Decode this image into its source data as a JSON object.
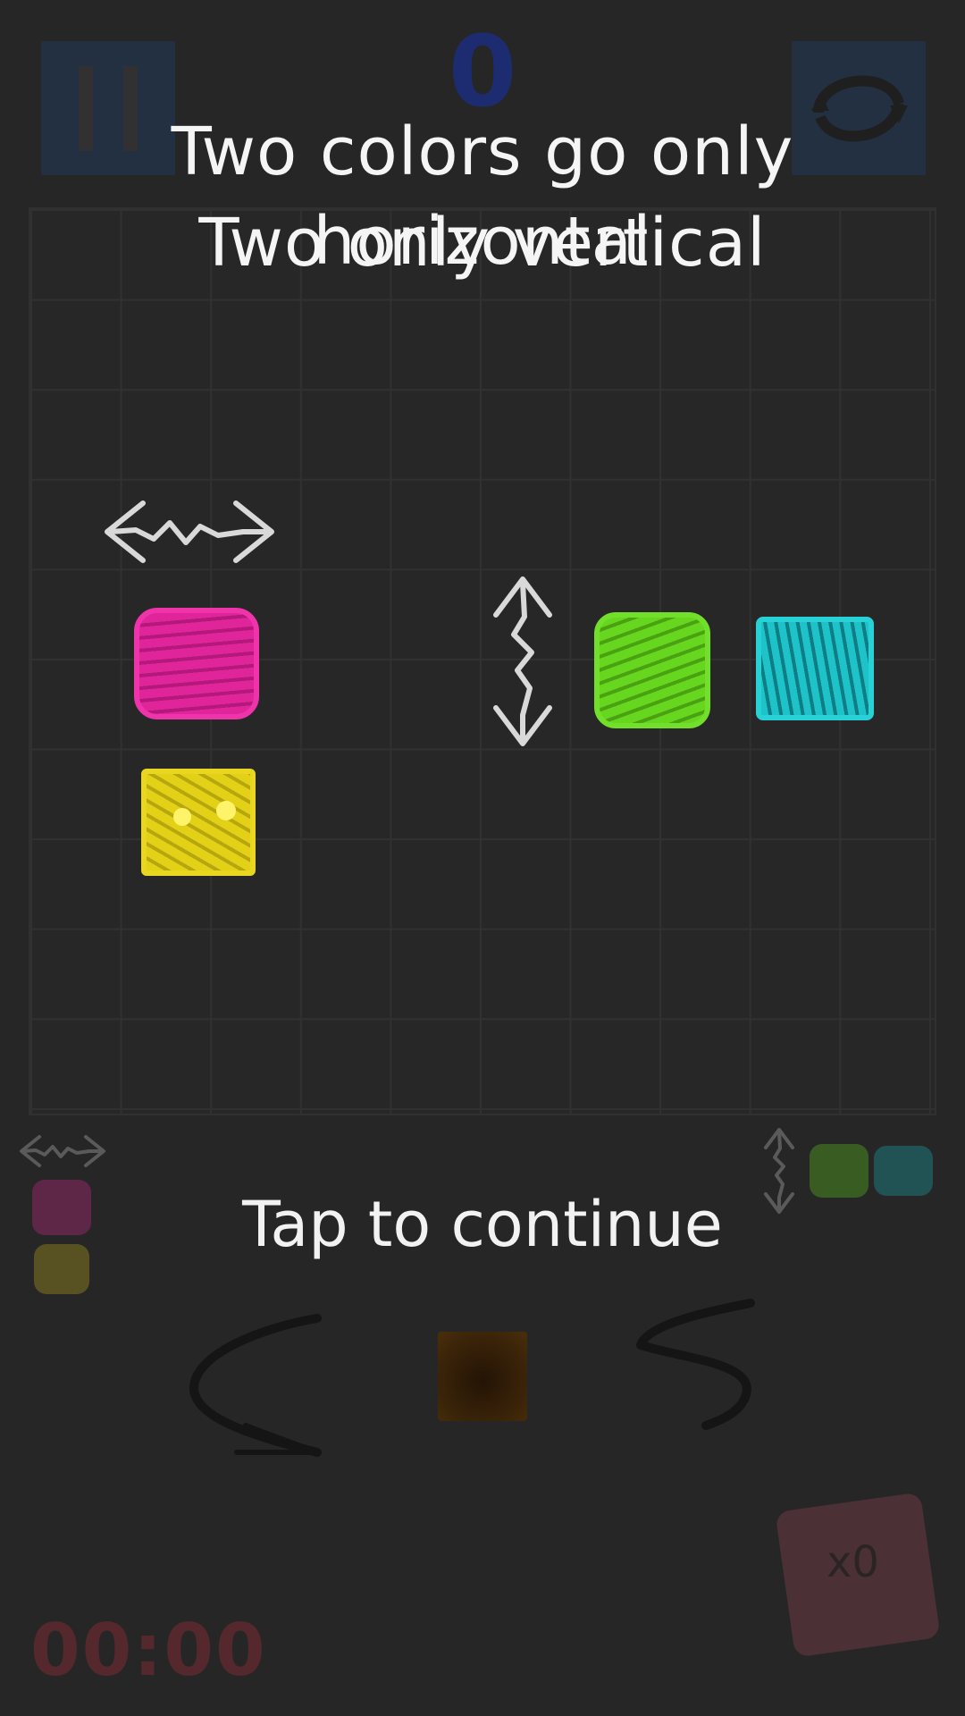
{
  "score": "0",
  "tutorial": {
    "line1": "Two colors go only horizontal",
    "line2": "Two only vertical",
    "tap": "Tap to continue"
  },
  "timer": "00:00",
  "powerup": {
    "count": "x0"
  },
  "icons": {
    "pause": "pause-icon",
    "restart": "restart-icon",
    "horizontal": "horizontal-arrows-icon",
    "vertical": "vertical-arrows-icon",
    "swipe_left": "swipe-left-arrow-icon",
    "swipe_right": "swipe-right-arrow-icon",
    "dice": "mystery-dice-icon"
  },
  "colors": {
    "magenta": "#e0249a",
    "yellow": "#e3d118",
    "green": "#67d61e",
    "cyan": "#1ec3c9",
    "background": "#262626",
    "timer": "#7a2b33"
  }
}
